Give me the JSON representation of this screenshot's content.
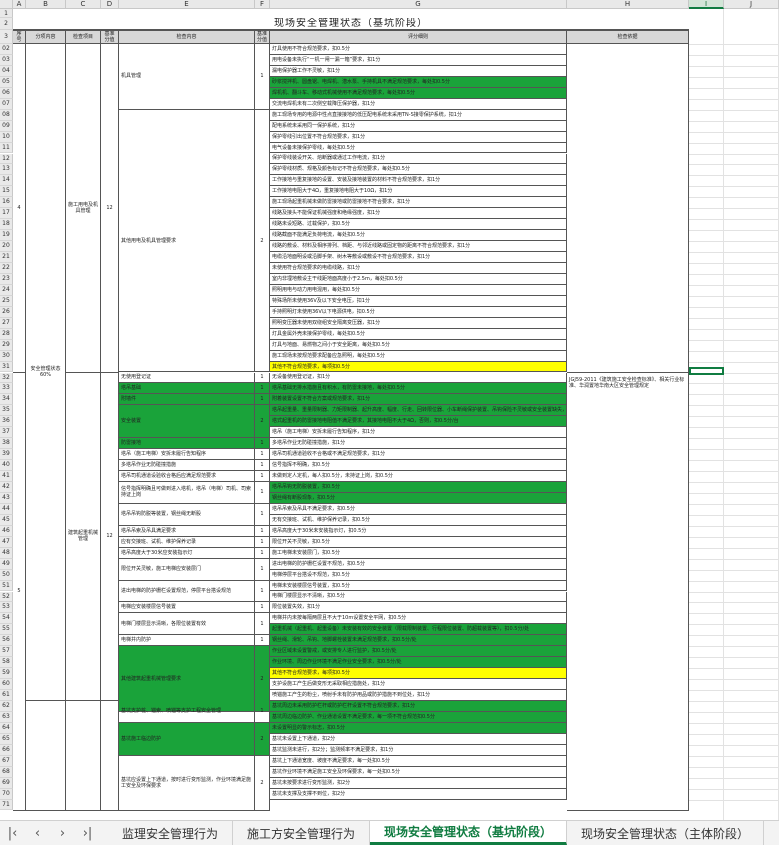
{
  "colors": {
    "accent": "#107c41",
    "green_fill": "#1aa33a",
    "yellow_fill": "#ffff00"
  },
  "columns": [
    "A",
    "B",
    "C",
    "D",
    "E",
    "F",
    "G",
    "H",
    "I",
    "J"
  ],
  "selected_column": "I",
  "rows": {
    "r1": "1",
    "r2": "2",
    "r3": "3",
    "list": [
      "02",
      "03",
      "04",
      "05",
      "06",
      "07",
      "08",
      "09",
      "10",
      "11",
      "12",
      "13",
      "14",
      "15",
      "16",
      "17",
      "18",
      "19",
      "20",
      "21",
      "22",
      "23",
      "24",
      "25",
      "26",
      "27",
      "28",
      "29",
      "30",
      "31",
      "32",
      "33",
      "34",
      "35",
      "36",
      "37",
      "38",
      "39",
      "40",
      "41",
      "42",
      "43",
      "44",
      "45",
      "46",
      "47",
      "48",
      "49",
      "50",
      "51",
      "52",
      "53",
      "54",
      "55",
      "56",
      "57",
      "58",
      "59",
      "60",
      "61",
      "62",
      "63",
      "64",
      "65",
      "66",
      "67",
      "68",
      "69",
      "70",
      "71"
    ]
  },
  "title": "现场安全管理状态（基坑阶段）",
  "headers": {
    "seq": "序号",
    "category": "分项内容",
    "item": "检查项目",
    "base": "基准分值",
    "content": "检查内容",
    "score": "基准分值",
    "rules": "评分细则",
    "basis": "检查依据"
  },
  "section_a": {
    "seq": "4",
    "category": "安全管理状态60%",
    "item": "施工用电及机具管理",
    "base": "12"
  },
  "section_b": {
    "seq": "5",
    "item": "建筑起重机械管理",
    "base": "12"
  },
  "contents": [
    {
      "text": "机具管理",
      "score": "1"
    },
    {
      "text": "其他用电及机具管理要求",
      "score": "2"
    },
    {
      "text": "无使用登记证",
      "score": "1"
    },
    {
      "text": "塔吊基础",
      "score": "1"
    },
    {
      "text": "附墙件",
      "score": "1"
    },
    {
      "text": "安全装置",
      "score": "2"
    },
    {
      "text": "防雷接地",
      "score": "1"
    },
    {
      "text": "塔吊（施工电梯）安拆未履行告知程序",
      "score": "1"
    },
    {
      "text": "多塔吊作业无防碰撞措施",
      "score": "1"
    },
    {
      "text": "塔吊司机通道设验收合格后应满足规范要求",
      "score": "1"
    },
    {
      "text": "信号指挥明确且可做到进入塔机，塔吊（电梯）司机、司索持证上岗",
      "score": "1"
    },
    {
      "text": "塔吊吊钩防脱等装置，钢丝绳无断股",
      "score": "1"
    },
    {
      "text": "塔吊吊索及吊具满足要求",
      "score": "1"
    },
    {
      "text": "应有交接班、试机、维护保养记录",
      "score": "1"
    },
    {
      "text": "塔吊高度大于30米应安装指示灯",
      "score": "1"
    },
    {
      "text": "限位开关灵敏，施工电梯应安装层门",
      "score": "1"
    },
    {
      "text": "进出电梯的防护栅栏设置规范，停层平台搭设规范",
      "score": "1"
    },
    {
      "text": "电梯应安装楼层信号装置",
      "score": "1"
    },
    {
      "text": "电梯门楼层显示清晰，各限位装置有效",
      "score": "1"
    },
    {
      "text": "电梯井内防护",
      "score": "1"
    },
    {
      "text": "其他建筑起重机械管理要求",
      "score": "2"
    },
    {
      "text": "基坑支护桩、锚索、喷锚等支护工程安全管理",
      "score": "1"
    },
    {
      "text": "基坑施工临边防护",
      "score": "2"
    },
    {
      "text": "基坑应设置上下通道，按时进行变形监测，作业环境满足施工安全及环保要求",
      "score": "2"
    }
  ],
  "rules": [
    {
      "text": "灯具使用不符合规范要求，扣0.5分"
    },
    {
      "text": "用电设备未执行“一机一闸一漏一箱”要求，扣1分"
    },
    {
      "text": "漏电保护器工作不灵敏，扣1分"
    },
    {
      "text": "砂浆搅拌机、圆盘锯、电焊机、潜水泵、手持机具不满足规范要求，每处扣0.5分",
      "fill": "green"
    },
    {
      "text": "焊机机、翻斗车、移动式机械使用不满足规范要求，每处扣0.5分",
      "fill": "green"
    },
    {
      "text": "交流电焊机未有二次侧空载降压保护器，扣1分"
    },
    {
      "text": "施工现场专用的电源中性点直接接地的低压配电系统未采用TN-S接零保护系统，扣1分"
    },
    {
      "text": "配电系统未采用同一保护系统，扣1分"
    },
    {
      "text": "保护零线引出位置不符合规范要求，扣1分"
    },
    {
      "text": "电气设备未接保护零线，每处扣0.5分"
    },
    {
      "text": "保护零线装设开关、熔断器或通过工作电流，扣1分"
    },
    {
      "text": "保护零线材质、规格及颜色标记不符合规范要求，每处扣0.5分"
    },
    {
      "text": "工作接地与重复接地的设置、安装及接地装置的材料不符合规范要求，扣1分"
    },
    {
      "text": "工作接地电阻大于4Ω，重复接地电阻大于10Ω，扣1分"
    },
    {
      "text": "施工现场起重机械未做防雷接地或防雷接地不符合要求，扣1分"
    },
    {
      "text": "线路及接头不能保证机械强度和绝缘强度，扣1分"
    },
    {
      "text": "线路未设短路、过载保护，扣0.5分"
    },
    {
      "text": "线路截面不能满足负荷电流，每处扣0.5分"
    },
    {
      "text": "线路的敷设、材料及相序排列、档距、与邻近线路或固定物的距离不符合规范要求，扣1分"
    },
    {
      "text": "电缆沿地面明设或沿脚手架、树木等敷设或敷设不符合规范要求，扣1分"
    },
    {
      "text": "未使用符合规范要求的电缆线路，扣1分"
    },
    {
      "text": "室内非埋地敷设主干线距地面高度小于2.5m，每处扣0.5分"
    },
    {
      "text": "照明用电与动力用电混用，每处扣0.5分"
    },
    {
      "text": "特殊场所未使用36V及以下安全电压，扣1分"
    },
    {
      "text": "手持照明灯未使用36V以下电源供电，扣0.5分"
    },
    {
      "text": "照明变压器未使用双绕组安全隔离变压器，扣1分"
    },
    {
      "text": "灯具金属外壳未接保护零线，每处扣0.5分"
    },
    {
      "text": "灯具与地面、易燃物之间小于安全距离，每处扣0.5分"
    },
    {
      "text": "施工现场未按规范要求配备应急照明，每处扣0.5分"
    },
    {
      "text": "其他不符合规范要求，每项扣0.5分",
      "fill": "yellow"
    },
    {
      "text": "无设备使用登记证，扣1分"
    },
    {
      "text": "塔吊基础无排水措施且有积水，有防雷未接地，每处扣0.5分",
      "fill": "green"
    },
    {
      "text": "附着装置设置不符合方案或规范要求，扣1分",
      "fill": "green"
    },
    {
      "text": "塔吊起重量、重量限制器、力矩限制器、起升高度、幅度、行走、回转限位器、小车断绳保护装置、吊钩保险不灵敏或安全装置缺失，每处扣0.5分",
      "fill": "green"
    },
    {
      "text": "塔式起重机的防雷接地电阻值不满足要求，其接地电阻不大于4Ω，否则，扣0.5分/台",
      "fill": "green"
    },
    {
      "text": "塔吊（施工电梯）安拆未履行告知程序，扣1分"
    },
    {
      "text": "多塔吊作业无防碰撞措施，扣1分"
    },
    {
      "text": "塔吊司机通道验收不合格或不满足规范要求，扣1分"
    },
    {
      "text": "信号指挥不明确，扣0.5分"
    },
    {
      "text": "未做到定人定机，每人扣0.5分，未持证上岗，扣0.5分"
    },
    {
      "text": "塔吊吊钩无防脱装置，扣0.5分",
      "fill": "green"
    },
    {
      "text": "钢丝绳有断股现象，扣0.5分",
      "fill": "green"
    },
    {
      "text": "塔吊吊索及吊具不满足要求，扣0.5分"
    },
    {
      "text": "无有交接班、试机、维护保养记录，扣0.5分"
    },
    {
      "text": "塔吊高度大于30米未安装指示灯，扣0.5分"
    },
    {
      "text": "限位开关不灵敏，扣0.5分"
    },
    {
      "text": "施工电梯未安装层门，扣0.5分"
    },
    {
      "text": "进出电梯的防护栅栏设置不规范，扣0.5分"
    },
    {
      "text": "电梯停层平台搭设不规范，扣0.5分"
    },
    {
      "text": "电梯未安装楼层信号装置，扣0.5分"
    },
    {
      "text": "电梯门楼层显示不清晰，扣0.5分"
    },
    {
      "text": "限位装置失效，扣1分"
    },
    {
      "text": "电梯井内未按每隔两层且不大于10m设置安全平网，扣0.5分"
    },
    {
      "text": "起重机械（起重机、起重设备）未安装有效的安全装置（限载限制装置、行程限位装置、防超载装置等），扣0.5分/处",
      "fill": "green"
    },
    {
      "text": "钢丝绳、滑轮、吊钩、地脚螺栓装置未满足规范要求，扣0.5分/处",
      "fill": "green"
    },
    {
      "text": "作业区域未设置警戒，或安排专人进行监护，扣0.5分/处",
      "fill": "green"
    },
    {
      "text": "作业环境、周边作业环境不满足作业安全要求，扣0.5分/处",
      "fill": "green"
    },
    {
      "text": "其他不符合规范要求，每项扣0.5分",
      "fill": "yellow"
    },
    {
      "text": "支护设施工产生后做变形无采取相应措施处，扣1分"
    },
    {
      "text": "喷锚施工产生的粉尘，喷射手未有防护用品或防护措施不到位处，扣1分"
    },
    {
      "text": "基坑周边未采用防护栏杆或防护栏杆设置不符合规范要求，扣1分",
      "fill": "green"
    },
    {
      "text": "基坑周边临边防护、作业通道设置不满足要求，每一项不符合规范扣0.5分",
      "fill": "green"
    },
    {
      "text": "未设置明显的警示标志，扣0.5分",
      "fill": "green"
    },
    {
      "text": "基坑未设置上下通道，扣2分"
    },
    {
      "text": "基坑监测未进行，扣2分；监测频率不满足要求，扣1分"
    },
    {
      "text": "基坑上下通道宽度、坡度不满足要求，每一处扣0.5分"
    },
    {
      "text": "基坑作业环境不满足施工安全及环保要求，每一处扣0.5分"
    },
    {
      "text": "基坑未按要求进行变形监测，扣2分"
    },
    {
      "text": "基坑未支撑及支撑不到位，扣2分"
    }
  ],
  "basis": "JGJ59-2011《建筑施工安全检查标准》、相关行业标准、华润置地华南大区安全管理规定",
  "tabs": [
    {
      "label": "监理安全管理行为",
      "active": false
    },
    {
      "label": "施工方安全管理行为",
      "active": false
    },
    {
      "label": "现场安全管理状态（基坑阶段）",
      "active": true
    },
    {
      "label": "现场安全管理状态（主体阶段）",
      "active": false
    }
  ],
  "nav_icons": [
    "first-sheet-icon",
    "prev-sheet-icon",
    "next-sheet-icon",
    "last-sheet-icon"
  ]
}
